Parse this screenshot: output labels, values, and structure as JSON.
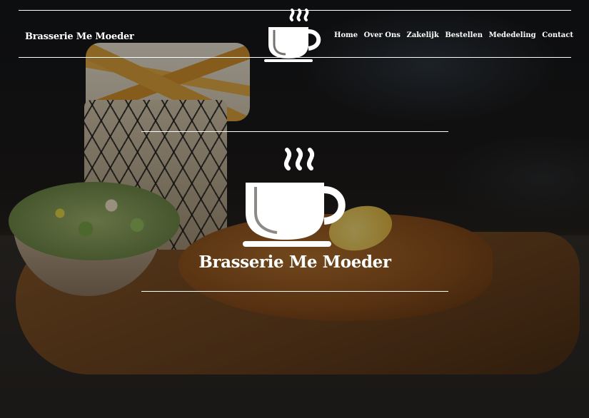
{
  "header": {
    "brand": "Brasserie Me Moeder",
    "logo_icon": "coffee-cup-icon"
  },
  "nav": {
    "items": [
      {
        "label": "Home"
      },
      {
        "label": "Over Ons"
      },
      {
        "label": "Zakelijk"
      },
      {
        "label": "Bestellen"
      },
      {
        "label": "Mededeling"
      },
      {
        "label": "Contact"
      }
    ]
  },
  "hero": {
    "title": "Brasserie Me Moeder",
    "logo_icon": "coffee-cup-icon"
  },
  "colors": {
    "text": "#ffffff",
    "overlay": "rgba(0,0,0,0.38)"
  }
}
